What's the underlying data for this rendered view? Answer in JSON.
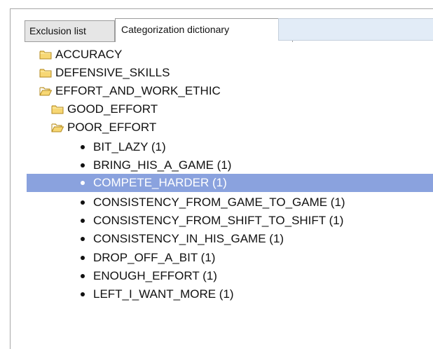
{
  "tabs": {
    "exclusion_label": "Exclusion list",
    "categorization_label": "Categorization dictionary"
  },
  "tree": {
    "categories": [
      {
        "label": "ACCURACY",
        "expanded": false
      },
      {
        "label": "DEFENSIVE_SKILLS",
        "expanded": false
      },
      {
        "label": "EFFORT_AND_WORK_ETHIC",
        "expanded": true
      }
    ],
    "subcategories": [
      {
        "label": "GOOD_EFFORT",
        "expanded": false
      },
      {
        "label": "POOR_EFFORT",
        "expanded": true
      }
    ],
    "entries": [
      {
        "label": "BIT_LAZY (1)",
        "selected": false
      },
      {
        "label": "BRING_HIS_A_GAME (1)",
        "selected": false
      },
      {
        "label": "COMPETE_HARDER (1)",
        "selected": true
      },
      {
        "label": "CONSISTENCY_FROM_GAME_TO_GAME (1)",
        "selected": false
      },
      {
        "label": "CONSISTENCY_FROM_SHIFT_TO_SHIFT (1)",
        "selected": false
      },
      {
        "label": "CONSISTENCY_IN_HIS_GAME (1)",
        "selected": false
      },
      {
        "label": "DROP_OFF_A_BIT (1)",
        "selected": false
      },
      {
        "label": "ENOUGH_EFFORT (1)",
        "selected": false
      },
      {
        "label": "LEFT_I_WANT_MORE (1)",
        "selected": false
      }
    ]
  },
  "colors": {
    "selection": "#8aa2de",
    "folder_fill": "#f7d774",
    "folder_stroke": "#b38a1e",
    "tab_filler": "#e2ecf7"
  }
}
